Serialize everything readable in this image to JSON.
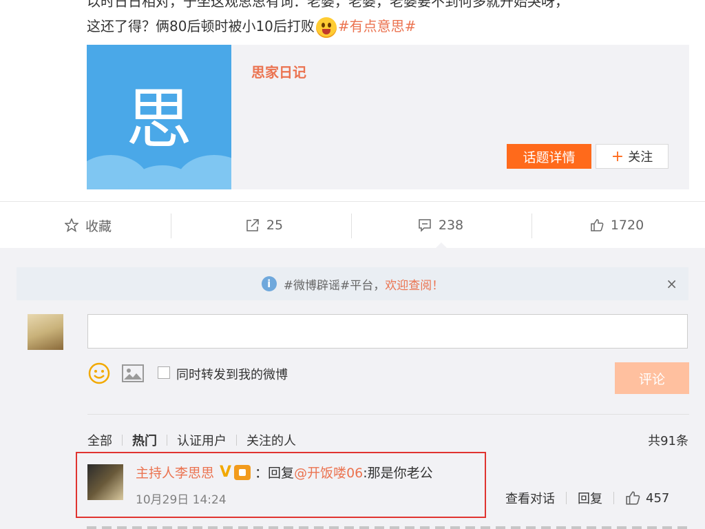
{
  "post": {
    "line1": "以时日日相对，于坐这观思思有词：老婆，老婆，老婆要不到何多就开始哭呀，",
    "line2_text": "这还了得？俩80后顿时被小10后打败",
    "line2_topic": "#有点意思#"
  },
  "card": {
    "glyph": "思",
    "title": "思家日记",
    "topic_button": "话题详情",
    "follow_plus": "+",
    "follow_label": "关注"
  },
  "actions": {
    "favorite": "收藏",
    "repost_count": "25",
    "comment_count": "238",
    "like_count": "1720"
  },
  "notice": {
    "info_glyph": "i",
    "prefix": "#微博辟谣#平台，",
    "highlight": "欢迎查阅！",
    "close": "×"
  },
  "composer": {
    "forward_label": "同时转发到我的微博",
    "submit_label": "评论"
  },
  "filters": {
    "items": [
      "全部",
      "热门",
      "认证用户",
      "关注的人"
    ],
    "active_index": 1,
    "total": "共91条"
  },
  "comment": {
    "author": "主持人李思思",
    "v_badge": "V",
    "sep": "：回复",
    "mention": "@开饭喽06",
    "text": ":那是你老公",
    "time": "10月29日 14:24",
    "view_dialog": "查看对话",
    "reply": "回复",
    "likes": "457"
  },
  "colors": {
    "accent": "#eb7350",
    "orange_button": "#ff6a1b",
    "highlight_border": "#e0332f"
  }
}
